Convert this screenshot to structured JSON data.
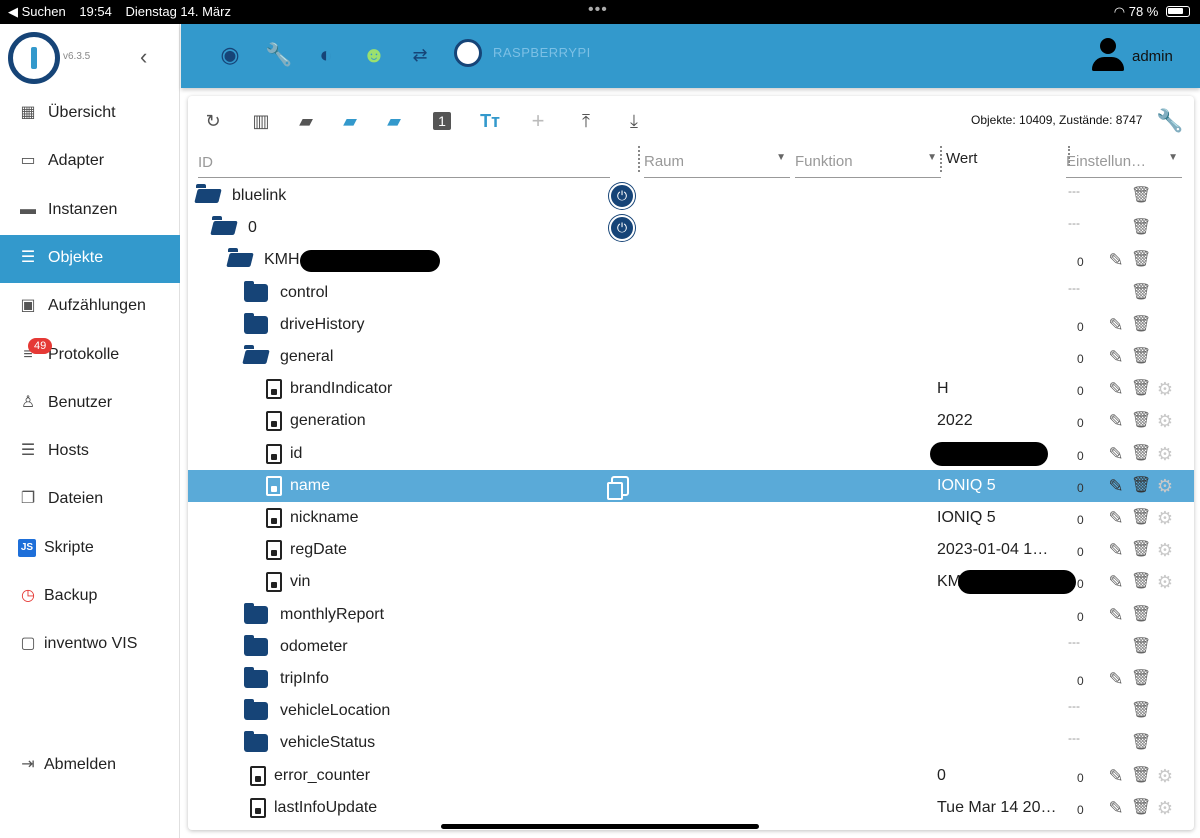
{
  "statusbar": {
    "back_app": "◀ Suchen",
    "time": "19:54",
    "date": "Dienstag 14. März",
    "battery": "78 %"
  },
  "sidebar": {
    "version": "v6.3.5",
    "items": [
      {
        "label": "Übersicht",
        "icon": "grid-icon"
      },
      {
        "label": "Adapter",
        "icon": "store-icon"
      },
      {
        "label": "Instanzen",
        "icon": "instances-icon"
      },
      {
        "label": "Objekte",
        "icon": "list-icon",
        "active": true
      },
      {
        "label": "Aufzählungen",
        "icon": "enum-icon"
      },
      {
        "label": "Protokolle",
        "icon": "log-icon",
        "badge": "49"
      },
      {
        "label": "Benutzer",
        "icon": "user-icon"
      },
      {
        "label": "Hosts",
        "icon": "hosts-icon"
      },
      {
        "label": "Dateien",
        "icon": "files-icon"
      },
      {
        "label": "Skripte",
        "icon": "js-icon"
      },
      {
        "label": "Backup",
        "icon": "backup-icon"
      },
      {
        "label": "inventwo VIS",
        "icon": "vis-icon"
      }
    ],
    "logout": "Abmelden"
  },
  "header": {
    "host": "RASPBERRYPI",
    "user": "admin"
  },
  "toolbar": {
    "counts": "Objekte: 10409, Zustände: 8747",
    "expand_level": "1"
  },
  "columns": {
    "id": "ID",
    "room": "Raum",
    "function": "Funktion",
    "value": "Wert",
    "settings": "Einstellun…"
  },
  "rows": [
    {
      "label": "bluelink",
      "type": "folder-open",
      "level": 0,
      "value": "",
      "num": "",
      "dash": "---",
      "adapter": true
    },
    {
      "label": "0",
      "type": "folder-open",
      "level": 1,
      "value": "",
      "num": "",
      "dash": "---",
      "adapter": true
    },
    {
      "label": "KMH",
      "type": "folder-open",
      "level": 2,
      "value": "",
      "num": "0",
      "dash": "",
      "redact": true
    },
    {
      "label": "control",
      "type": "folder",
      "level": 3,
      "value": "",
      "num": "",
      "dash": "---"
    },
    {
      "label": "driveHistory",
      "type": "folder",
      "level": 3,
      "value": "",
      "num": "0",
      "dash": ""
    },
    {
      "label": "general",
      "type": "folder-open",
      "level": 3,
      "value": "",
      "num": "0",
      "dash": ""
    },
    {
      "label": "brandIndicator",
      "type": "state",
      "level": 4,
      "value": "H",
      "num": "0",
      "dash": ""
    },
    {
      "label": "generation",
      "type": "state",
      "level": 4,
      "value": "2022",
      "num": "0",
      "dash": ""
    },
    {
      "label": "id",
      "type": "state",
      "level": 4,
      "value": "",
      "num": "0",
      "dash": "",
      "redactval": true
    },
    {
      "label": "name",
      "type": "state",
      "level": 4,
      "value": "IONIQ 5",
      "num": "0",
      "dash": "",
      "selected": true
    },
    {
      "label": "nickname",
      "type": "state",
      "level": 4,
      "value": "IONIQ 5",
      "num": "0",
      "dash": ""
    },
    {
      "label": "regDate",
      "type": "state",
      "level": 4,
      "value": "2023-01-04 1…",
      "num": "0",
      "dash": ""
    },
    {
      "label": "vin",
      "type": "state",
      "level": 4,
      "value": "KM",
      "num": "0",
      "dash": "",
      "redactval": true
    },
    {
      "label": "monthlyReport",
      "type": "folder",
      "level": 3,
      "value": "",
      "num": "0",
      "dash": ""
    },
    {
      "label": "odometer",
      "type": "folder",
      "level": 3,
      "value": "",
      "num": "",
      "dash": "---"
    },
    {
      "label": "tripInfo",
      "type": "folder",
      "level": 3,
      "value": "",
      "num": "0",
      "dash": ""
    },
    {
      "label": "vehicleLocation",
      "type": "folder",
      "level": 3,
      "value": "",
      "num": "",
      "dash": "---"
    },
    {
      "label": "vehicleStatus",
      "type": "folder",
      "level": 3,
      "value": "",
      "num": "",
      "dash": "---"
    },
    {
      "label": "error_counter",
      "type": "state",
      "level": 3,
      "value": "0",
      "num": "0",
      "dash": ""
    },
    {
      "label": "lastInfoUpdate",
      "type": "state",
      "level": 3,
      "value": "Tue Mar 14 20…",
      "num": "0",
      "dash": ""
    }
  ]
}
